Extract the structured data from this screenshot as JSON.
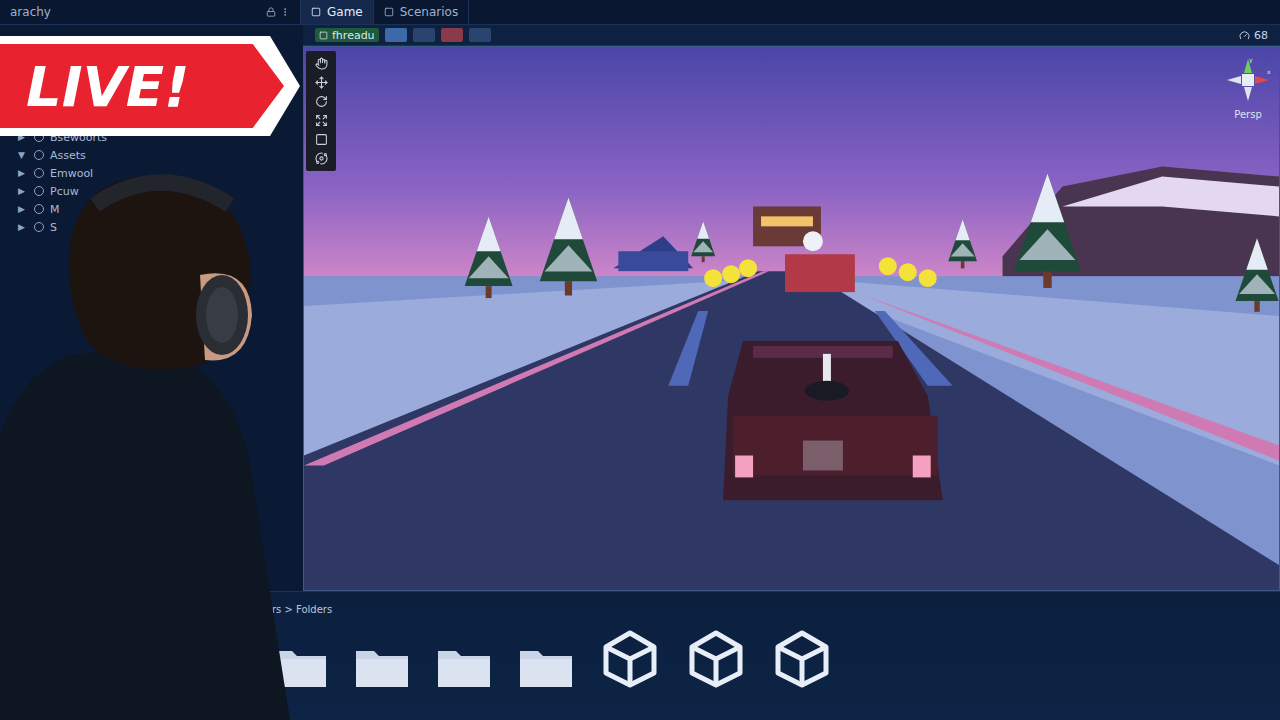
{
  "badge": {
    "label": "LIVE!"
  },
  "editor_tabs": [
    {
      "label": "arachy",
      "selected": false
    },
    {
      "label": "Game",
      "selected": true
    },
    {
      "label": "Scenarios",
      "selected": false
    }
  ],
  "game_toolbar": {
    "display": "fhreadu",
    "stats": "68"
  },
  "hierarchy": {
    "items": [
      {
        "label": "Bsewoorts",
        "expanded": false
      },
      {
        "label": "Assets",
        "expanded": true
      },
      {
        "label": "Emwool",
        "expanded": false
      },
      {
        "label": "Pcuw",
        "expanded": false
      },
      {
        "label": "M",
        "expanded": false
      },
      {
        "label": "S",
        "expanded": false
      }
    ]
  },
  "scene_gizmo": {
    "axes": [
      "y",
      "x"
    ],
    "projection": "Persp"
  },
  "project": {
    "breadcrumb": "rs > Folders",
    "items": [
      {
        "kind": "folder"
      },
      {
        "kind": "folder"
      },
      {
        "kind": "folder"
      },
      {
        "kind": "folder"
      },
      {
        "kind": "unity"
      },
      {
        "kind": "unity"
      },
      {
        "kind": "unity"
      }
    ]
  }
}
